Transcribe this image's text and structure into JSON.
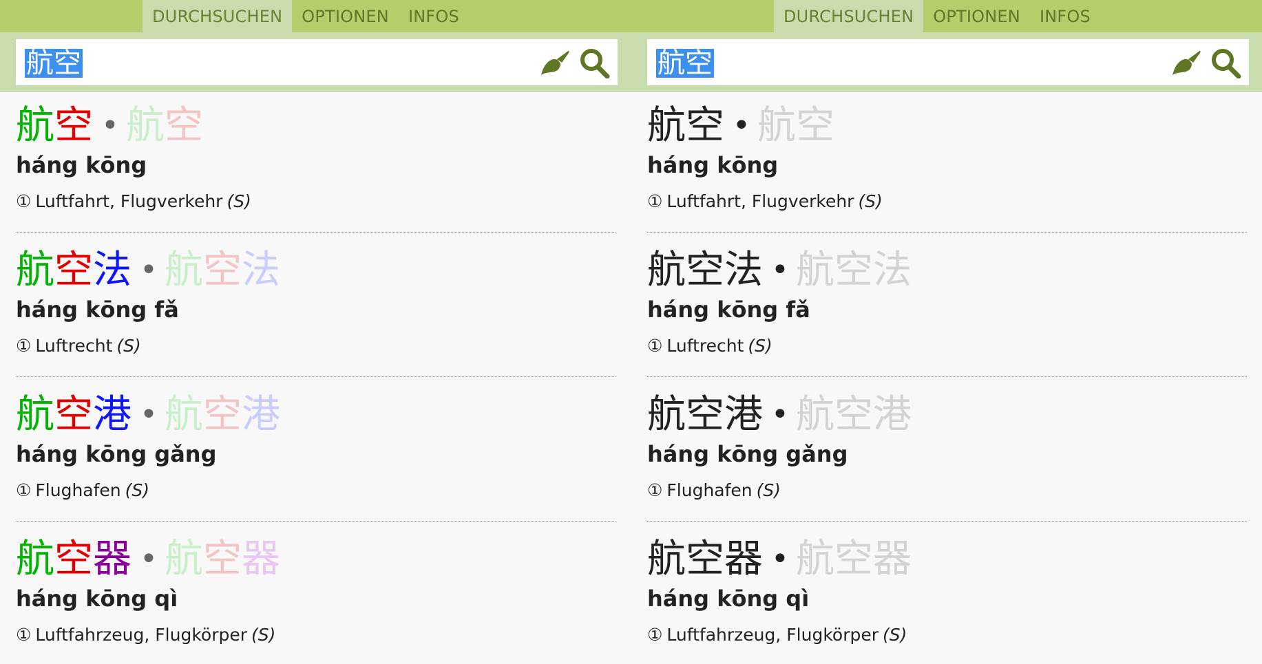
{
  "colors": {
    "nav_bg": "#b3ce6a",
    "search_band_bg": "#c8dcae",
    "search_box_bg": "#ffffff",
    "selection_bg": "#3b8ff0",
    "tone_green": "#00b400",
    "tone_red": "#e00000",
    "tone_blue": "#0d16ff",
    "tone_purple": "#8b009b",
    "tone_green_light": "#c9efc9",
    "tone_red_light": "#f2c4c4",
    "tone_blue_light": "#c9ccff",
    "tone_purple_light": "#e8c8f0",
    "text_dark": "#222222",
    "text_gray_light": "#d3d3d3"
  },
  "panels": [
    {
      "tabs": [
        "DURCHSUCHEN",
        "OPTIONEN",
        "INFOS"
      ],
      "active_tab": "DURCHSUCHEN",
      "search_value": "航空",
      "brush_icon": "brush-icon",
      "search_icon": "search-icon",
      "entries": [
        {
          "hanzi": [
            {
              "char": "航",
              "color": "#00b400"
            },
            {
              "char": "空",
              "color": "#e00000"
            }
          ],
          "hanzi_faded": [
            {
              "char": "航",
              "color": "#c9efc9"
            },
            {
              "char": "空",
              "color": "#f2c4c4"
            }
          ],
          "pinyin": "háng kōng",
          "meaning": "Luftfahrt, Flugverkehr",
          "num": "①",
          "pos": "(S)"
        },
        {
          "hanzi": [
            {
              "char": "航",
              "color": "#00b400"
            },
            {
              "char": "空",
              "color": "#e00000"
            },
            {
              "char": "法",
              "color": "#0d16ff"
            }
          ],
          "hanzi_faded": [
            {
              "char": "航",
              "color": "#c9efc9"
            },
            {
              "char": "空",
              "color": "#f2c4c4"
            },
            {
              "char": "法",
              "color": "#c9ccff"
            }
          ],
          "pinyin": "háng kōng fǎ",
          "meaning": "Luftrecht",
          "num": "①",
          "pos": "(S)"
        },
        {
          "hanzi": [
            {
              "char": "航",
              "color": "#00b400"
            },
            {
              "char": "空",
              "color": "#e00000"
            },
            {
              "char": "港",
              "color": "#0d16ff"
            }
          ],
          "hanzi_faded": [
            {
              "char": "航",
              "color": "#c9efc9"
            },
            {
              "char": "空",
              "color": "#f2c4c4"
            },
            {
              "char": "港",
              "color": "#c9ccff"
            }
          ],
          "pinyin": "háng kōng gǎng",
          "meaning": "Flughafen",
          "num": "①",
          "pos": "(S)"
        },
        {
          "hanzi": [
            {
              "char": "航",
              "color": "#00b400"
            },
            {
              "char": "空",
              "color": "#e00000"
            },
            {
              "char": "器",
              "color": "#8b009b"
            }
          ],
          "hanzi_faded": [
            {
              "char": "航",
              "color": "#c9efc9"
            },
            {
              "char": "空",
              "color": "#f2c4c4"
            },
            {
              "char": "器",
              "color": "#e8c8f0"
            }
          ],
          "pinyin": "háng kōng qì",
          "meaning": "Luftfahrzeug, Flugkörper",
          "num": "①",
          "pos": "(S)"
        }
      ]
    },
    {
      "tabs": [
        "DURCHSUCHEN",
        "OPTIONEN",
        "INFOS"
      ],
      "active_tab": "DURCHSUCHEN",
      "search_value": "航空",
      "brush_icon": "brush-icon",
      "search_icon": "search-icon",
      "entries": [
        {
          "hanzi": [
            {
              "char": "航",
              "color": "#222222"
            },
            {
              "char": "空",
              "color": "#222222"
            }
          ],
          "hanzi_faded": [
            {
              "char": "航",
              "color": "#d3d3d3"
            },
            {
              "char": "空",
              "color": "#d3d3d3"
            }
          ],
          "pinyin": "háng kōng",
          "meaning": "Luftfahrt, Flugverkehr",
          "num": "①",
          "pos": "(S)"
        },
        {
          "hanzi": [
            {
              "char": "航",
              "color": "#222222"
            },
            {
              "char": "空",
              "color": "#222222"
            },
            {
              "char": "法",
              "color": "#222222"
            }
          ],
          "hanzi_faded": [
            {
              "char": "航",
              "color": "#d3d3d3"
            },
            {
              "char": "空",
              "color": "#d3d3d3"
            },
            {
              "char": "法",
              "color": "#d3d3d3"
            }
          ],
          "pinyin": "háng kōng fǎ",
          "meaning": "Luftrecht",
          "num": "①",
          "pos": "(S)"
        },
        {
          "hanzi": [
            {
              "char": "航",
              "color": "#222222"
            },
            {
              "char": "空",
              "color": "#222222"
            },
            {
              "char": "港",
              "color": "#222222"
            }
          ],
          "hanzi_faded": [
            {
              "char": "航",
              "color": "#d3d3d3"
            },
            {
              "char": "空",
              "color": "#d3d3d3"
            },
            {
              "char": "港",
              "color": "#d3d3d3"
            }
          ],
          "pinyin": "háng kōng gǎng",
          "meaning": "Flughafen",
          "num": "①",
          "pos": "(S)"
        },
        {
          "hanzi": [
            {
              "char": "航",
              "color": "#222222"
            },
            {
              "char": "空",
              "color": "#222222"
            },
            {
              "char": "器",
              "color": "#222222"
            }
          ],
          "hanzi_faded": [
            {
              "char": "航",
              "color": "#d3d3d3"
            },
            {
              "char": "空",
              "color": "#d3d3d3"
            },
            {
              "char": "器",
              "color": "#d3d3d3"
            }
          ],
          "pinyin": "háng kōng qì",
          "meaning": "Luftfahrzeug, Flugkörper",
          "num": "①",
          "pos": "(S)"
        }
      ]
    }
  ]
}
